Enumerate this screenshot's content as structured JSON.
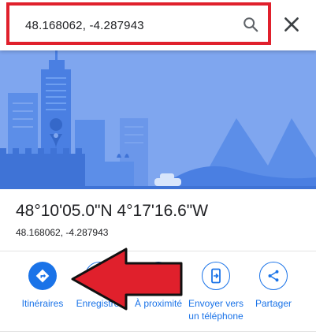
{
  "search": {
    "query": "48.168062, -4.287943"
  },
  "place": {
    "title": "48°10'05.0\"N 4°17'16.6\"W",
    "subtitle": "48.168062, -4.287943"
  },
  "actions": [
    {
      "label": "Itinéraires",
      "icon": "directions-icon"
    },
    {
      "label": "Enregistrer",
      "icon": "bookmark-icon"
    },
    {
      "label": "À proximité",
      "icon": "nearby-icon"
    },
    {
      "label_line1": "Envoyer vers",
      "label_line2": "un téléphone",
      "icon": "send-to-phone-icon"
    },
    {
      "label": "Partager",
      "icon": "share-icon"
    }
  ],
  "colors": {
    "accent": "#1a73e8",
    "annotation": "#e0202c",
    "hero_sky": "#7fa6ef"
  }
}
